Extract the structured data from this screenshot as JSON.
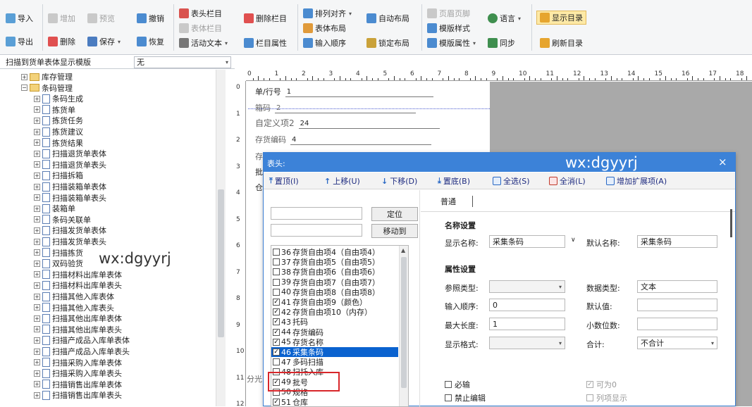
{
  "ribbon": {
    "import": "导入",
    "export": "导出",
    "add": "增加",
    "delete": "删除",
    "preview": "预览",
    "save": "保存",
    "undo": "撤销",
    "restore": "恢复",
    "header_col": "表头栏目",
    "body_col": "表体栏目",
    "active_text": "活动文本",
    "delete_col": "删除栏目",
    "col_props": "栏目属性",
    "arrange_align": "排列对齐",
    "body_layout": "表体布局",
    "input_order": "输入顺序",
    "auto_layout": "自动布局",
    "lock_layout": "锁定布局",
    "header_footer": "页眉页脚",
    "template_style": "模版样式",
    "template_props": "模版属性",
    "language": "语言",
    "sync": "同步",
    "show_toc": "显示目录",
    "refresh_toc": "刷新目录"
  },
  "template_bar": {
    "label": "扫描到货单表体显示模版",
    "value": "无"
  },
  "tree": {
    "items": [
      {
        "label": "库存管理",
        "level": 1,
        "kind": "folder",
        "expanded": false
      },
      {
        "label": "条码管理",
        "level": 1,
        "kind": "folder",
        "expanded": true
      },
      {
        "label": "条码生成",
        "level": 2,
        "kind": "doc"
      },
      {
        "label": "拣货单",
        "level": 2,
        "kind": "doc"
      },
      {
        "label": "拣货任务",
        "level": 2,
        "kind": "doc"
      },
      {
        "label": "拣货建议",
        "level": 2,
        "kind": "doc"
      },
      {
        "label": "拣货结果",
        "level": 2,
        "kind": "doc"
      },
      {
        "label": "扫描退货单表体",
        "level": 2,
        "kind": "doc"
      },
      {
        "label": "扫描退货单表头",
        "level": 2,
        "kind": "doc"
      },
      {
        "label": "扫描拆箱",
        "level": 2,
        "kind": "doc"
      },
      {
        "label": "扫描装箱单表体",
        "level": 2,
        "kind": "doc"
      },
      {
        "label": "扫描装箱单表头",
        "level": 2,
        "kind": "doc"
      },
      {
        "label": "装箱单",
        "level": 2,
        "kind": "doc"
      },
      {
        "label": "条码关联单",
        "level": 2,
        "kind": "doc"
      },
      {
        "label": "扫描发货单表体",
        "level": 2,
        "kind": "doc"
      },
      {
        "label": "扫描发货单表头",
        "level": 2,
        "kind": "doc"
      },
      {
        "label": "扫描拣货",
        "level": 2,
        "kind": "doc"
      },
      {
        "label": "双码验货",
        "level": 2,
        "kind": "doc"
      },
      {
        "label": "扫描材料出库单表体",
        "level": 2,
        "kind": "doc"
      },
      {
        "label": "扫描材料出库单表头",
        "level": 2,
        "kind": "doc"
      },
      {
        "label": "扫描其他入库表体",
        "level": 2,
        "kind": "doc"
      },
      {
        "label": "扫描其他入库表头",
        "level": 2,
        "kind": "doc"
      },
      {
        "label": "扫描其他出库单表体",
        "level": 2,
        "kind": "doc"
      },
      {
        "label": "扫描其他出库单表头",
        "level": 2,
        "kind": "doc"
      },
      {
        "label": "扫描产成品入库单表体",
        "level": 2,
        "kind": "doc"
      },
      {
        "label": "扫描产成品入库单表头",
        "level": 2,
        "kind": "doc"
      },
      {
        "label": "扫描采购入库单表体",
        "level": 2,
        "kind": "doc"
      },
      {
        "label": "扫描采购入库单表头",
        "level": 2,
        "kind": "doc"
      },
      {
        "label": "扫描销售出库单表体",
        "level": 2,
        "kind": "doc"
      },
      {
        "label": "扫描销售出库单表头",
        "level": 2,
        "kind": "doc"
      }
    ]
  },
  "watermark": "wx:dgyyrj",
  "ruler": {
    "top": [
      "0",
      "1",
      "2",
      "3",
      "4",
      "5",
      "6",
      "7",
      "8",
      "9",
      "10",
      "11",
      "12",
      "13",
      "14",
      "15",
      "16",
      "17",
      "18"
    ],
    "left": [
      "0",
      "1",
      "2",
      "3",
      "4",
      "5",
      "6",
      "7",
      "8",
      "9",
      "10",
      "11",
      "12"
    ]
  },
  "design": {
    "fields": [
      {
        "label": "单/行号",
        "value": "1"
      },
      {
        "label": "箱码",
        "value": "2"
      },
      {
        "label": "自定义项2",
        "value": "24"
      },
      {
        "label": "存货编码",
        "value": "4"
      },
      {
        "label": "存",
        "value": ""
      },
      {
        "label": "批",
        "value": ""
      },
      {
        "label": "仓",
        "value": ""
      }
    ],
    "bottom_label": "分光"
  },
  "dialog": {
    "title": "表头:",
    "close": "×",
    "toolbar": [
      {
        "label": "置顶(I)",
        "icon": "top-icon"
      },
      {
        "label": "上移(U)",
        "icon": "up-icon"
      },
      {
        "label": "下移(D)",
        "icon": "down-icon"
      },
      {
        "label": "置底(B)",
        "icon": "bottom-icon"
      },
      {
        "label": "全选(S)",
        "icon": "select-all-icon"
      },
      {
        "label": "全消(L)",
        "icon": "clear-all-icon"
      },
      {
        "label": "增加扩展项(A)",
        "icon": "add-ext-icon"
      }
    ],
    "locate_btn": "定位",
    "moveto_btn": "移动到",
    "list": [
      {
        "num": "36",
        "label": "存货自由项4（自由项4）",
        "checked": false,
        "selected": false
      },
      {
        "num": "37",
        "label": "存货自由项5（自由项5）",
        "checked": false,
        "selected": false
      },
      {
        "num": "38",
        "label": "存货自由项6（自由项6）",
        "checked": false,
        "selected": false
      },
      {
        "num": "39",
        "label": "存货自由项7（自由项7）",
        "checked": false,
        "selected": false
      },
      {
        "num": "40",
        "label": "存货自由项8（自由项8）",
        "checked": false,
        "selected": false
      },
      {
        "num": "41",
        "label": "存货自由项9（颜色）",
        "checked": true,
        "selected": false
      },
      {
        "num": "42",
        "label": "存货自由项10（内存）",
        "checked": true,
        "selected": false
      },
      {
        "num": "43",
        "label": "托码",
        "checked": true,
        "selected": false
      },
      {
        "num": "44",
        "label": "存货编码",
        "checked": true,
        "selected": false
      },
      {
        "num": "45",
        "label": "存货名称",
        "checked": true,
        "selected": false
      },
      {
        "num": "46",
        "label": "采集条码",
        "checked": true,
        "selected": true
      },
      {
        "num": "47",
        "label": "多码扫描",
        "checked": false,
        "selected": false
      },
      {
        "num": "48",
        "label": "扫托入库",
        "checked": false,
        "selected": false
      },
      {
        "num": "49",
        "label": "批号",
        "checked": true,
        "selected": false
      },
      {
        "num": "50",
        "label": "规格",
        "checked": false,
        "selected": false
      },
      {
        "num": "51",
        "label": "仓库",
        "checked": true,
        "selected": false
      }
    ],
    "tab": "普通",
    "name_section": "名称设置",
    "display_name_label": "显示名称:",
    "display_name_value": "采集条码",
    "default_name_label": "默认名称:",
    "default_name_value": "采集条码",
    "attr_section": "属性设置",
    "ref_type_label": "参照类型:",
    "ref_type_value": "",
    "data_type_label": "数据类型:",
    "data_type_value": "文本",
    "input_order_label": "输入顺序:",
    "input_order_value": "0",
    "default_value_label": "默认值:",
    "default_value_value": "",
    "max_length_label": "最大长度:",
    "max_length_value": "1",
    "decimals_label": "小数位数:",
    "decimals_value": "",
    "display_format_label": "显示格式:",
    "display_format_value": "",
    "total_label": "合计:",
    "total_value": "不合计",
    "required_label": "必输",
    "no_edit_label": "禁止编辑",
    "can_zero_label": "可为0",
    "list_display_label": "列项显示"
  }
}
